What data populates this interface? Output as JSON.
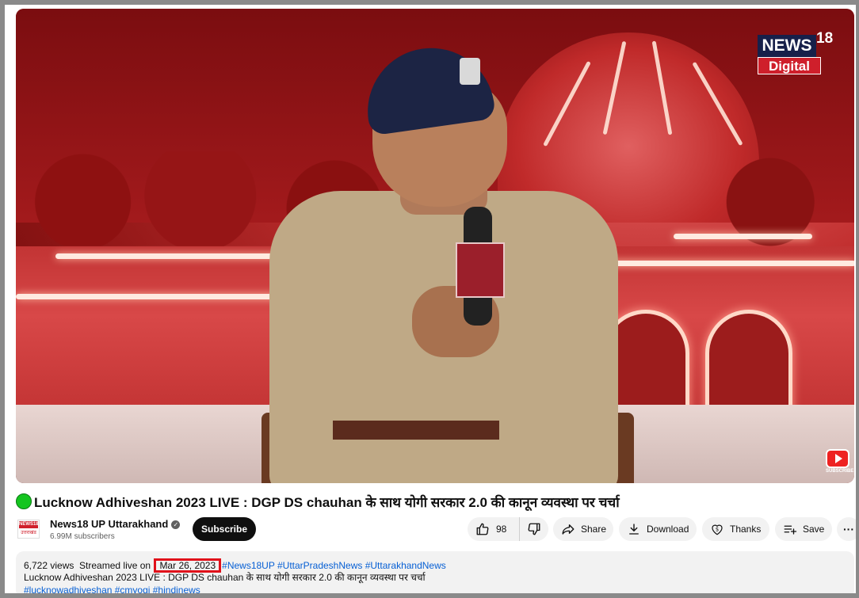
{
  "video": {
    "brand_logo_top": "NEWS",
    "brand_logo_num": "18",
    "brand_logo_bottom": "Digital",
    "subscribe_watermark_label": "SUBSCRIBE"
  },
  "title": {
    "live_indicator_color": "#15c520",
    "text": "Lucknow Adhiveshan 2023 LIVE : DGP DS chauhan के साथ योगी सरकार 2.0 की कानून व्यवस्था पर चर्चा"
  },
  "channel": {
    "avatar_top": "NEWS18",
    "avatar_bottom": "उत्तराखंड",
    "name": "News18 UP Uttarakhand",
    "subscribers": "6.99M subscribers",
    "subscribe_label": "Subscribe"
  },
  "actions": {
    "like_count": "98",
    "share_label": "Share",
    "download_label": "Download",
    "thanks_label": "Thanks",
    "save_label": "Save",
    "more_label": "···"
  },
  "description": {
    "views": "6,722 views",
    "streamed_prefix": "Streamed live on",
    "date": "Mar 26, 2023",
    "hashtags": [
      "#News18UP",
      "#UttarPradeshNews",
      "#UttarakhandNews"
    ],
    "line2": "Lucknow Adhiveshan 2023 LIVE : DGP DS chauhan के साथ योगी सरकार 2.0 की कानून व्यवस्था पर चर्चा",
    "line3": "#lucknowadhiveshan #cmyogi #hindinews",
    "highlight_color": "#e0101a"
  }
}
